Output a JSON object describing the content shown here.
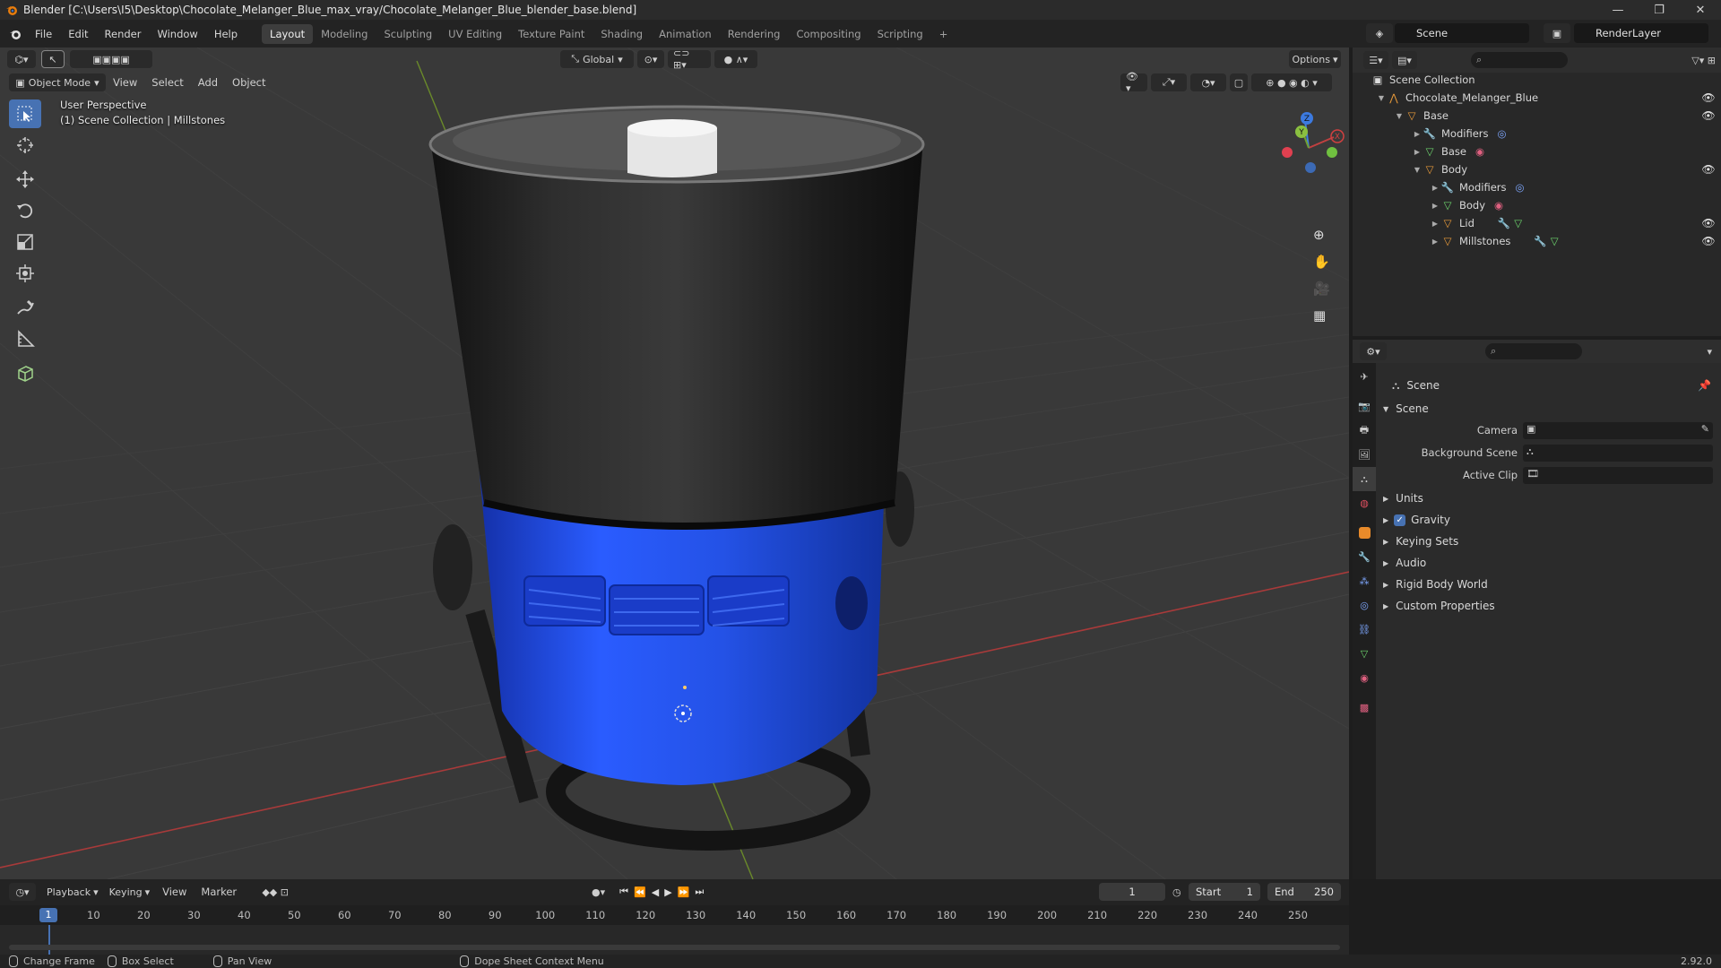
{
  "window": {
    "title": "Blender [C:\\Users\\I5\\Desktop\\Chocolate_Melanger_Blue_max_vray/Chocolate_Melanger_Blue_blender_base.blend]",
    "minimize": "—",
    "maximize": "❐",
    "close": "✕"
  },
  "menu": [
    "File",
    "Edit",
    "Render",
    "Window",
    "Help"
  ],
  "workspaces": [
    "Layout",
    "Modeling",
    "Sculpting",
    "UV Editing",
    "Texture Paint",
    "Shading",
    "Animation",
    "Rendering",
    "Compositing",
    "Scripting"
  ],
  "workspace_add": "+",
  "scene_name": "Scene",
  "view_layer": "RenderLayer",
  "viewport": {
    "mode": "Object Mode",
    "menus": [
      "View",
      "Select",
      "Add",
      "Object"
    ],
    "orientation": "Global",
    "options": "Options",
    "perspective_label": "User Perspective",
    "collection_label": "(1) Scene Collection | Millstones",
    "axis_labels": {
      "x": "X",
      "y": "Y",
      "z": "Z"
    }
  },
  "tools": [
    "select-box",
    "cursor",
    "move",
    "rotate",
    "scale",
    "transform",
    "annotate",
    "measure",
    "add-cube"
  ],
  "outliner": {
    "root": "Scene Collection",
    "items": [
      {
        "label": "Chocolate_Melanger_Blue",
        "icon": "empty",
        "level": 1,
        "expanded": true,
        "eye": true
      },
      {
        "label": "Base",
        "icon": "mesh-object",
        "level": 2,
        "expanded": true,
        "eye": true
      },
      {
        "label": "Modifiers",
        "icon": "wrench",
        "level": 3,
        "expanded": false,
        "eye": false
      },
      {
        "label": "Base",
        "icon": "mesh-data",
        "level": 3,
        "expanded": false,
        "eye": false
      },
      {
        "label": "Body",
        "icon": "mesh-object",
        "level": 3,
        "expanded": true,
        "eye": true
      },
      {
        "label": "Modifiers",
        "icon": "wrench",
        "level": 4,
        "expanded": false,
        "eye": false
      },
      {
        "label": "Body",
        "icon": "mesh-data",
        "level": 4,
        "expanded": false,
        "eye": false
      },
      {
        "label": "Lid",
        "icon": "mesh-object",
        "level": 4,
        "expanded": false,
        "eye": true
      },
      {
        "label": "Millstones",
        "icon": "mesh-object",
        "level": 4,
        "expanded": false,
        "eye": true
      }
    ]
  },
  "properties": {
    "context": "Scene",
    "panel_title": "Scene",
    "fields": [
      {
        "label": "Camera",
        "value": ""
      },
      {
        "label": "Background Scene",
        "value": ""
      },
      {
        "label": "Active Clip",
        "value": ""
      }
    ],
    "subpanels": [
      "Units",
      "Gravity",
      "Keying Sets",
      "Audio",
      "Rigid Body World",
      "Custom Properties"
    ],
    "gravity_checked": true
  },
  "timeline": {
    "menus": [
      "Playback",
      "Keying",
      "View",
      "Marker"
    ],
    "current_frame": "1",
    "start_label": "Start",
    "start": "1",
    "end_label": "End",
    "end": "250",
    "ticks": [
      "1",
      "10",
      "20",
      "30",
      "40",
      "50",
      "60",
      "70",
      "80",
      "90",
      "100",
      "110",
      "120",
      "130",
      "140",
      "150",
      "160",
      "170",
      "180",
      "190",
      "200",
      "210",
      "220",
      "230",
      "240",
      "250"
    ]
  },
  "statusbar": {
    "items": [
      "Change Frame",
      "Box Select",
      "Pan View",
      "Dope Sheet Context Menu"
    ],
    "version": "2.92.0"
  },
  "colors": {
    "accent": "#4772b3",
    "object_blue": "#2450e0",
    "header_bg": "#232323",
    "viewport_bg": "#393939"
  }
}
